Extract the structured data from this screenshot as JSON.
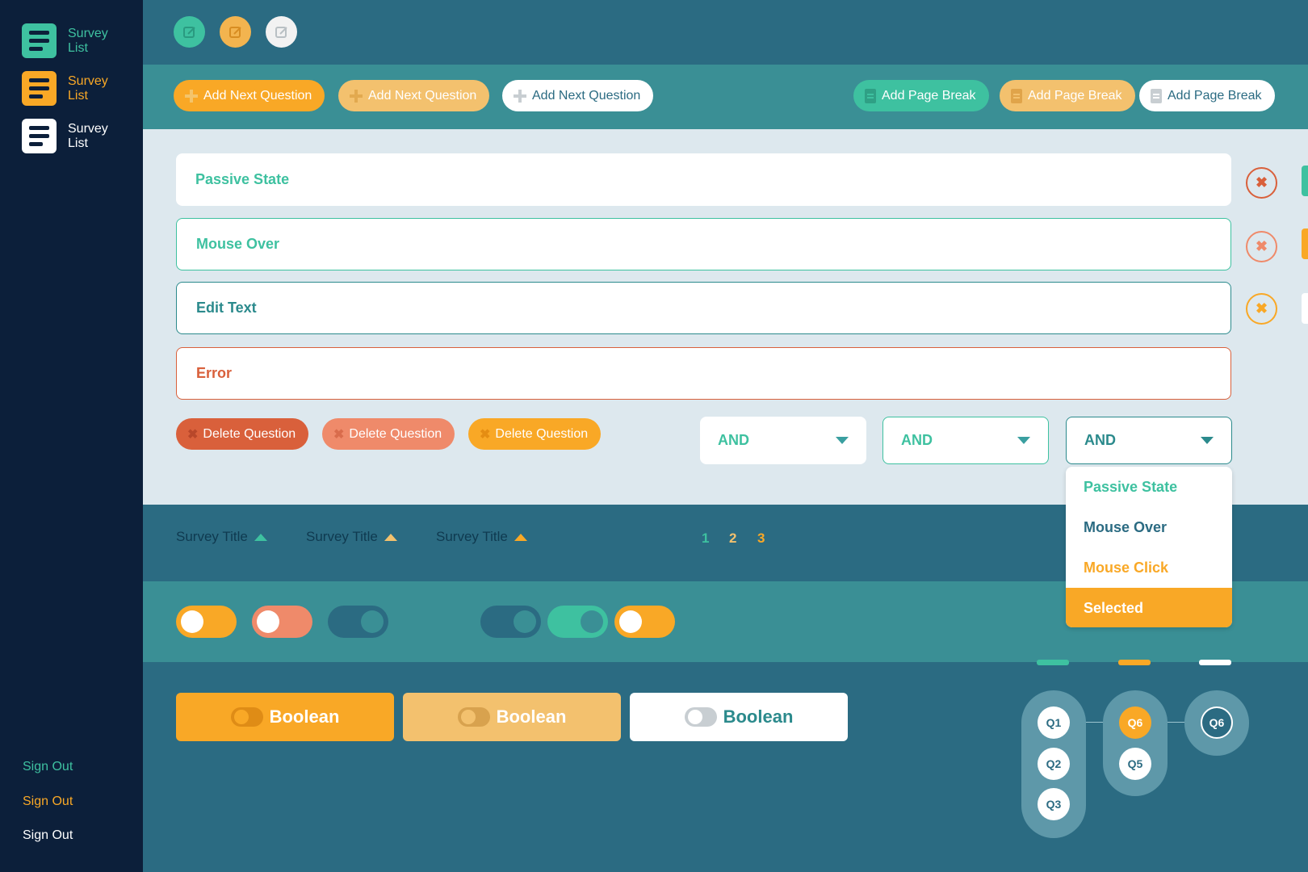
{
  "sidebar": {
    "items": [
      {
        "label": "Survey List",
        "color": "#3ec1a0"
      },
      {
        "label": "Survey List",
        "color": "#f9a826"
      },
      {
        "label": "Survey List",
        "color": "#ffffff"
      }
    ],
    "signouts": [
      {
        "label": "Sign Out",
        "color": "#3ec1a0"
      },
      {
        "label": "Sign Out",
        "color": "#f9a826"
      },
      {
        "label": "Sign Out",
        "color": "#ffffff"
      }
    ]
  },
  "topbar": {
    "edit_buttons": [
      {
        "icon": "edit-icon",
        "color": "#3ec1a0"
      },
      {
        "icon": "edit-icon",
        "color": "#f3b44f"
      },
      {
        "icon": "edit-icon",
        "color": "#f2f2f2"
      }
    ]
  },
  "actions": {
    "add_question": [
      "Add Next Question",
      "Add Next Question",
      "Add Next Question"
    ],
    "add_page_break": [
      "Add Page Break",
      "Add Page Break",
      "Add Page Break"
    ]
  },
  "fields": {
    "passive": "Passive State",
    "mouse_over": "Mouse Over",
    "edit_text": "Edit Text",
    "error": "Error"
  },
  "delete_buttons": [
    "Delete Question",
    "Delete Question",
    "Delete Question"
  ],
  "selects": [
    "AND",
    "AND",
    "AND"
  ],
  "dropdown": {
    "options": [
      "Passive State",
      "Mouse Over",
      "Mouse Click",
      "Selected"
    ]
  },
  "table": {
    "sort_headers": [
      "Survey Title",
      "Survey Title",
      "Survey Title"
    ],
    "pages": [
      "1",
      "2",
      "3"
    ]
  },
  "booleans": [
    "Boolean",
    "Boolean",
    "Boolean"
  ],
  "questions": {
    "col1": [
      "Q1",
      "Q2",
      "Q3"
    ],
    "col2": [
      "Q6",
      "Q5"
    ],
    "col3": [
      "Q6"
    ]
  },
  "colors": {
    "teal": "#3ec1a0",
    "orange": "#f9a826",
    "light_orange": "#f3c16e",
    "salmon": "#ef8a6a",
    "red": "#d9603b",
    "navy": "#0c1f3a",
    "dark_teal": "#2b6b82"
  }
}
